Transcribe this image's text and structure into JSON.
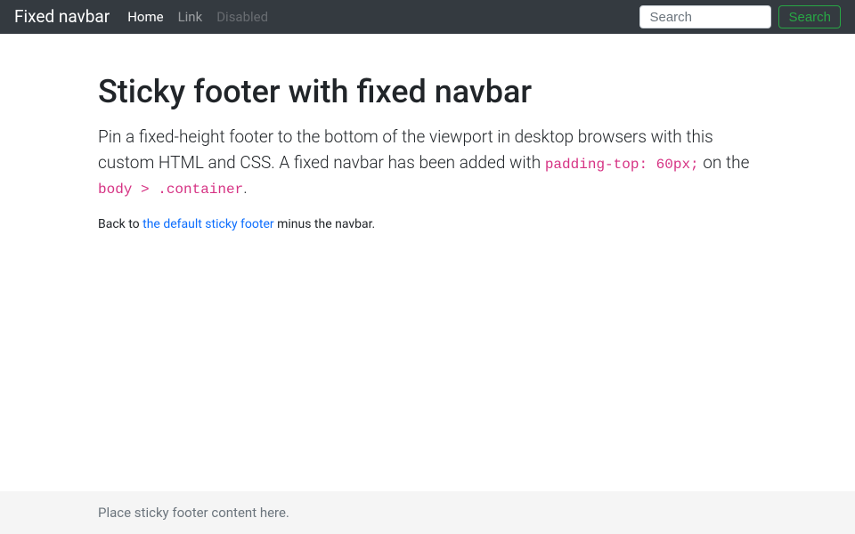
{
  "navbar": {
    "brand": "Fixed navbar",
    "links": [
      {
        "label": "Home",
        "state": "active"
      },
      {
        "label": "Link",
        "state": "normal"
      },
      {
        "label": "Disabled",
        "state": "disabled"
      }
    ],
    "search": {
      "placeholder": "Search",
      "button_label": "Search"
    }
  },
  "main": {
    "heading": "Sticky footer with fixed navbar",
    "lead_part1": "Pin a fixed-height footer to the bottom of the viewport in desktop browsers with this custom HTML and CSS. A fixed navbar has been added with ",
    "code1": "padding-top: 60px;",
    "lead_part2": " on the ",
    "code2": "body > .container",
    "lead_part3": ".",
    "back_part1": "Back to ",
    "back_link": "the default sticky footer",
    "back_part2": " minus the navbar."
  },
  "footer": {
    "text": "Place sticky footer content here."
  }
}
